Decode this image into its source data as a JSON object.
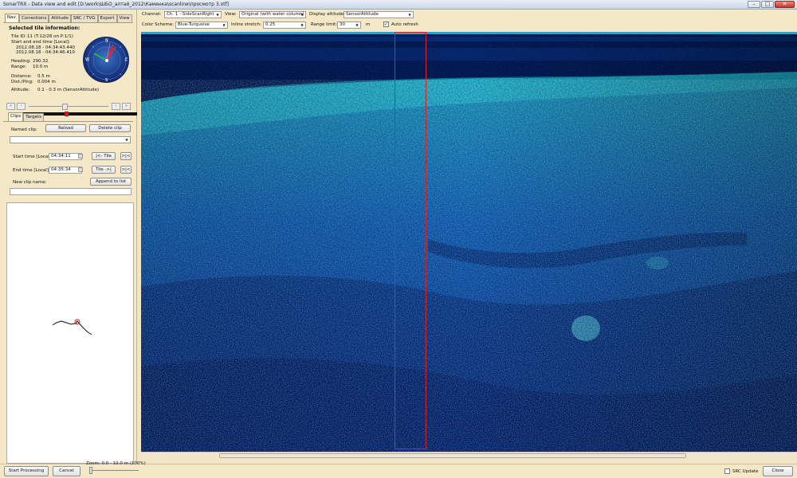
{
  "window": {
    "title": "SonarTRX - Data view and edit [D:\\work\\ШБО_алтай_2012\\Каменка\\scanline\\просмотр 3.xtf]",
    "minimize_label": "–",
    "maximize_label": "□",
    "close_label": "✕"
  },
  "left_tabs": [
    "Nav.",
    "Corrections",
    "Altitude",
    "SRC / TVG",
    "Export",
    "View"
  ],
  "nav": {
    "heading": "Selected tile information:",
    "tile_id_label": "Tile ID:",
    "tile_id_value": "11 (T:12/28 on P:1/1)",
    "start_end_label": "Start and end time [Local]:",
    "start_time": "2012.08.18 - 04:34:43.440",
    "end_time": "2012.08.18 - 04:34:46.410",
    "heading_label": "Heading:",
    "heading_value": "290.32",
    "range_label": "Range:",
    "range_value": "10.0 m",
    "distance_label": "Distance:",
    "distance_value": "0.5 m",
    "dist_ping_label": "Dist./Ping:",
    "dist_ping_value": "0.004 m",
    "altitude_label": "Altitude:",
    "altitude_value": "0.1 - 0.3 m (SensorAttitude)",
    "compass_letters": {
      "n": "N",
      "e": "E",
      "s": "S",
      "w": "W"
    },
    "nav_buttons": [
      "«",
      "‹",
      "›",
      "»"
    ],
    "track_position": 0.38
  },
  "clips": {
    "tabs": [
      "Clips",
      "Targets"
    ],
    "named_clip_label": "Named clip:",
    "reload_label": "Reload",
    "delete_label": "Delete clip",
    "clip_value": "",
    "start_time_label": "Start time [Local]:",
    "start_time_value": "04:34:11",
    "end_time_label": "End time [Local]:",
    "end_time_value": "04:35:34",
    "tile_start_label": "|<- Tile",
    "tile_end_label": "Tile ->|",
    "first_label": ">|<",
    "last_label": ">|<",
    "new_clip_label": "New clip name:",
    "append_label": "Append to list",
    "new_clip_value": ""
  },
  "toolbar": {
    "channel_label": "Channel:",
    "channel_value": "Ch. 1 - SideScanRight",
    "view_label": "View:",
    "view_value": "Original (with water column)",
    "display_altitude_label": "Display altitude:",
    "display_altitude_value": "SensorAttitude",
    "color_scheme_label": "Color Scheme:",
    "color_scheme_value": "Blue-Turquoise",
    "inline_stretch_label": "Inline stretch:",
    "inline_stretch_value": "0.25",
    "range_limit_label": "Range limit:",
    "range_limit_value": "30",
    "range_unit": "m",
    "auto_refresh_label": "Auto refresh",
    "auto_refresh_checked": true
  },
  "status": {
    "start_processing_label": "Start Processing",
    "cancel_label": "Cancel",
    "zoom_label": "Zoom: 0.0 - 10.0 m (100%)",
    "src_update_label": "SRC Update",
    "close_label": "Close"
  },
  "colors": {
    "panel_bg": "#f4e8c7",
    "sonar_dark": "#021046",
    "sonar_mid": "#0b3a96",
    "sonar_bright": "#21b8c6",
    "selection": "#e02020"
  }
}
